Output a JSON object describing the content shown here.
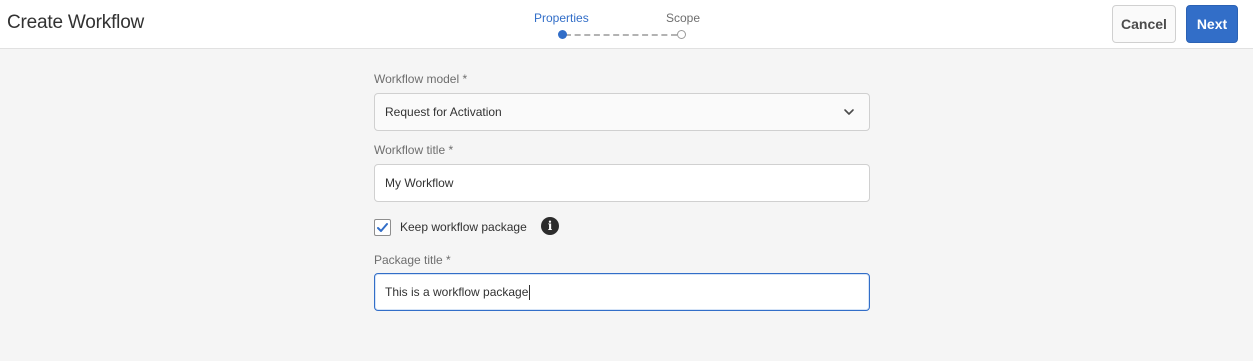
{
  "header": {
    "title": "Create Workflow",
    "steps": [
      {
        "label": "Properties",
        "state": "active"
      },
      {
        "label": "Scope",
        "state": "inactive"
      }
    ],
    "cancel_label": "Cancel",
    "next_label": "Next"
  },
  "form": {
    "workflow_model": {
      "label": "Workflow model *",
      "value": "Request for Activation"
    },
    "workflow_title": {
      "label": "Workflow title *",
      "value": "My Workflow"
    },
    "keep_package": {
      "label": "Keep workflow package",
      "checked": true
    },
    "package_title": {
      "label": "Package title *",
      "value": "This is a workflow package"
    }
  },
  "icons": {
    "select_indicator": "chevron-down-icon",
    "checkbox_mark": "checkmark-icon",
    "info": "info-icon"
  },
  "colors": {
    "accent": "#326ec8",
    "background": "#f5f5f5"
  }
}
